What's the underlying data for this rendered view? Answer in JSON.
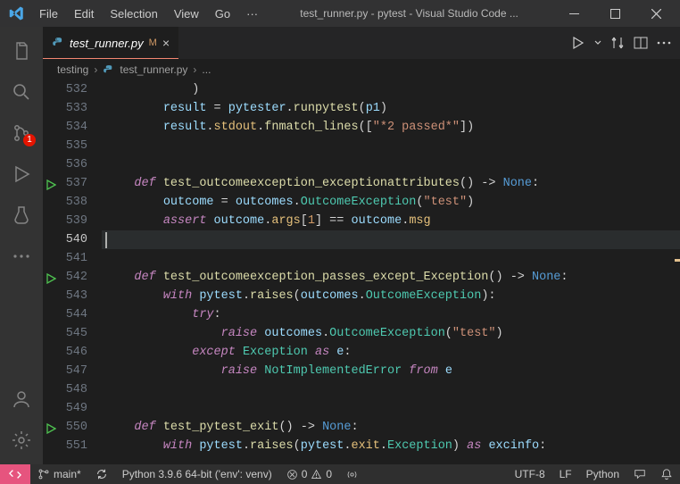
{
  "menubar": {
    "items": [
      "File",
      "Edit",
      "Selection",
      "View",
      "Go",
      "···"
    ]
  },
  "window": {
    "title": "test_runner.py - pytest - Visual Studio Code ..."
  },
  "tab": {
    "filename": "test_runner.py",
    "modified_marker": "M",
    "close_glyph": "×"
  },
  "breadcrumb": {
    "seg0": "testing",
    "seg1": "test_runner.py",
    "seg2": "..."
  },
  "activity_badge": "1",
  "gutter": {
    "lines": [
      "532",
      "533",
      "534",
      "535",
      "536",
      "537",
      "538",
      "539",
      "540",
      "541",
      "542",
      "543",
      "544",
      "545",
      "546",
      "547",
      "548",
      "549",
      "550",
      "551"
    ],
    "current_index": 8
  },
  "testing_gutter": {
    "play_at": [
      5,
      10,
      18
    ]
  },
  "code": {
    "lines": [
      {
        "i": 0,
        "seg": [
          {
            "t": "            ",
            "c": "op"
          },
          {
            "t": ")",
            "c": "pn"
          }
        ]
      },
      {
        "i": 1,
        "seg": [
          {
            "t": "        ",
            "c": "op"
          },
          {
            "t": "result",
            "c": "var"
          },
          {
            "t": " = ",
            "c": "op"
          },
          {
            "t": "pytester",
            "c": "obj"
          },
          {
            "t": ".",
            "c": "op"
          },
          {
            "t": "runpytest",
            "c": "fn"
          },
          {
            "t": "(",
            "c": "pn"
          },
          {
            "t": "p1",
            "c": "var"
          },
          {
            "t": ")",
            "c": "pn"
          }
        ]
      },
      {
        "i": 2,
        "seg": [
          {
            "t": "        ",
            "c": "op"
          },
          {
            "t": "result",
            "c": "var"
          },
          {
            "t": ".",
            "c": "op"
          },
          {
            "t": "stdout",
            "c": "prop"
          },
          {
            "t": ".",
            "c": "op"
          },
          {
            "t": "fnmatch_lines",
            "c": "fn"
          },
          {
            "t": "([",
            "c": "pn"
          },
          {
            "t": "\"*2 passed*\"",
            "c": "str"
          },
          {
            "t": "])",
            "c": "pn"
          }
        ]
      },
      {
        "i": 3,
        "seg": []
      },
      {
        "i": 4,
        "seg": []
      },
      {
        "i": 5,
        "seg": [
          {
            "t": "    ",
            "c": "op"
          },
          {
            "t": "def",
            "c": "kw"
          },
          {
            "t": " ",
            "c": "op"
          },
          {
            "t": "test_outcomeexception_exceptionattributes",
            "c": "fn"
          },
          {
            "t": "() -> ",
            "c": "pn"
          },
          {
            "t": "None",
            "c": "const"
          },
          {
            "t": ":",
            "c": "pn"
          }
        ]
      },
      {
        "i": 6,
        "seg": [
          {
            "t": "        ",
            "c": "op"
          },
          {
            "t": "outcome",
            "c": "var"
          },
          {
            "t": " = ",
            "c": "op"
          },
          {
            "t": "outcomes",
            "c": "obj"
          },
          {
            "t": ".",
            "c": "op"
          },
          {
            "t": "OutcomeException",
            "c": "cls"
          },
          {
            "t": "(",
            "c": "pn"
          },
          {
            "t": "\"test\"",
            "c": "str"
          },
          {
            "t": ")",
            "c": "pn"
          }
        ]
      },
      {
        "i": 7,
        "seg": [
          {
            "t": "        ",
            "c": "op"
          },
          {
            "t": "assert",
            "c": "kw"
          },
          {
            "t": " ",
            "c": "op"
          },
          {
            "t": "outcome",
            "c": "var"
          },
          {
            "t": ".",
            "c": "op"
          },
          {
            "t": "args",
            "c": "prop"
          },
          {
            "t": "[",
            "c": "pn"
          },
          {
            "t": "1",
            "c": "num"
          },
          {
            "t": "] == ",
            "c": "op"
          },
          {
            "t": "outcome",
            "c": "var"
          },
          {
            "t": ".",
            "c": "op"
          },
          {
            "t": "msg",
            "c": "prop"
          }
        ]
      },
      {
        "i": 8,
        "seg": []
      },
      {
        "i": 9,
        "seg": []
      },
      {
        "i": 10,
        "seg": [
          {
            "t": "    ",
            "c": "op"
          },
          {
            "t": "def",
            "c": "kw"
          },
          {
            "t": " ",
            "c": "op"
          },
          {
            "t": "test_outcomeexception_passes_except_Exception",
            "c": "fn"
          },
          {
            "t": "() -> ",
            "c": "pn"
          },
          {
            "t": "None",
            "c": "const"
          },
          {
            "t": ":",
            "c": "pn"
          }
        ]
      },
      {
        "i": 11,
        "seg": [
          {
            "t": "        ",
            "c": "op"
          },
          {
            "t": "with",
            "c": "kw"
          },
          {
            "t": " ",
            "c": "op"
          },
          {
            "t": "pytest",
            "c": "obj"
          },
          {
            "t": ".",
            "c": "op"
          },
          {
            "t": "raises",
            "c": "fn"
          },
          {
            "t": "(",
            "c": "pn"
          },
          {
            "t": "outcomes",
            "c": "obj"
          },
          {
            "t": ".",
            "c": "op"
          },
          {
            "t": "OutcomeException",
            "c": "cls"
          },
          {
            "t": "):",
            "c": "pn"
          }
        ]
      },
      {
        "i": 12,
        "seg": [
          {
            "t": "            ",
            "c": "op"
          },
          {
            "t": "try",
            "c": "kw"
          },
          {
            "t": ":",
            "c": "pn"
          }
        ]
      },
      {
        "i": 13,
        "seg": [
          {
            "t": "                ",
            "c": "op"
          },
          {
            "t": "raise",
            "c": "kw"
          },
          {
            "t": " ",
            "c": "op"
          },
          {
            "t": "outcomes",
            "c": "obj"
          },
          {
            "t": ".",
            "c": "op"
          },
          {
            "t": "OutcomeException",
            "c": "cls"
          },
          {
            "t": "(",
            "c": "pn"
          },
          {
            "t": "\"test\"",
            "c": "str"
          },
          {
            "t": ")",
            "c": "pn"
          }
        ]
      },
      {
        "i": 14,
        "seg": [
          {
            "t": "            ",
            "c": "op"
          },
          {
            "t": "except",
            "c": "kw"
          },
          {
            "t": " ",
            "c": "op"
          },
          {
            "t": "Exception",
            "c": "cls"
          },
          {
            "t": " ",
            "c": "op"
          },
          {
            "t": "as",
            "c": "kw"
          },
          {
            "t": " ",
            "c": "op"
          },
          {
            "t": "e",
            "c": "var"
          },
          {
            "t": ":",
            "c": "pn"
          }
        ]
      },
      {
        "i": 15,
        "seg": [
          {
            "t": "                ",
            "c": "op"
          },
          {
            "t": "raise",
            "c": "kw"
          },
          {
            "t": " ",
            "c": "op"
          },
          {
            "t": "NotImplementedError",
            "c": "cls"
          },
          {
            "t": " ",
            "c": "op"
          },
          {
            "t": "from",
            "c": "kw"
          },
          {
            "t": " ",
            "c": "op"
          },
          {
            "t": "e",
            "c": "var"
          }
        ]
      },
      {
        "i": 16,
        "seg": []
      },
      {
        "i": 17,
        "seg": []
      },
      {
        "i": 18,
        "seg": [
          {
            "t": "    ",
            "c": "op"
          },
          {
            "t": "def",
            "c": "kw"
          },
          {
            "t": " ",
            "c": "op"
          },
          {
            "t": "test_pytest_exit",
            "c": "fn"
          },
          {
            "t": "() -> ",
            "c": "pn"
          },
          {
            "t": "None",
            "c": "const"
          },
          {
            "t": ":",
            "c": "pn"
          }
        ]
      },
      {
        "i": 19,
        "seg": [
          {
            "t": "        ",
            "c": "op"
          },
          {
            "t": "with",
            "c": "kw"
          },
          {
            "t": " ",
            "c": "op"
          },
          {
            "t": "pytest",
            "c": "obj"
          },
          {
            "t": ".",
            "c": "op"
          },
          {
            "t": "raises",
            "c": "fn"
          },
          {
            "t": "(",
            "c": "pn"
          },
          {
            "t": "pytest",
            "c": "obj"
          },
          {
            "t": ".",
            "c": "op"
          },
          {
            "t": "exit",
            "c": "prop"
          },
          {
            "t": ".",
            "c": "op"
          },
          {
            "t": "Exception",
            "c": "cls"
          },
          {
            "t": ") ",
            "c": "pn"
          },
          {
            "t": "as",
            "c": "kw"
          },
          {
            "t": " ",
            "c": "op"
          },
          {
            "t": "excinfo",
            "c": "var"
          },
          {
            "t": ":",
            "c": "pn"
          }
        ]
      }
    ]
  },
  "status": {
    "branch": "main*",
    "interpreter": "Python 3.9.6 64-bit ('env': venv)",
    "problems_errors": "0",
    "problems_warnings": "0",
    "encoding": "UTF-8",
    "eol": "LF",
    "language": "Python",
    "tweet_glyph": ""
  }
}
